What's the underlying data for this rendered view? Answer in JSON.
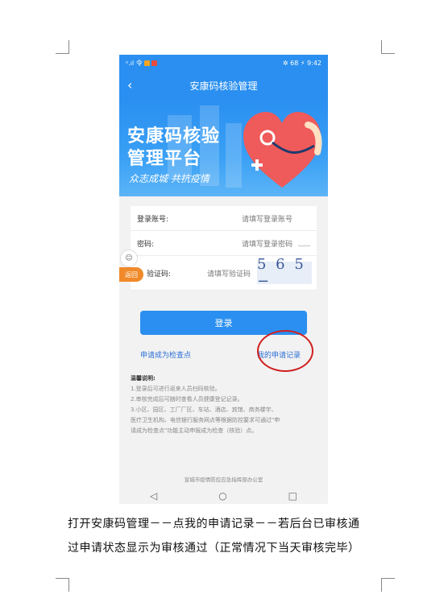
{
  "status_bar": {
    "left": "ᵘ.ıl 令",
    "right": "✲ 68 ⚡ 9:42"
  },
  "nav": {
    "back_icon": "‹",
    "title": "安康码核验管理"
  },
  "banner": {
    "line1": "安康码核验",
    "line2": "管理平台",
    "slogan": "众志成城 共抗疫情"
  },
  "form": {
    "account_label": "登录账号:",
    "account_placeholder": "请填写登录账号",
    "password_label": "密码:",
    "password_placeholder": "请填写登录密码",
    "eye_icon": "‿‿",
    "captcha_label": "验证码:",
    "captcha_placeholder": "请填写验证码",
    "captcha_text": "5 6 5 −"
  },
  "float": {
    "robot_icon": "☺",
    "return_label": "返回"
  },
  "login_button": "登录",
  "links": {
    "apply": "申请成为检查点",
    "records": "我的申请记录"
  },
  "tips": {
    "title": "温馨说明:",
    "items": [
      "1.登录后可进行返来人员扫码核验。",
      "2.审核完成后可随时查看人员健康登记记录。",
      "3.小区、园区、工厂厂区、车站、酒店、宾馆、商务楼宇、",
      "医疗卫生机构、电信银行服务网点等根据防控要求可通过\"申",
      "请成为检查点\"功能主动申报成为检查（核验）点。"
    ]
  },
  "footer": "宣城市疫情防控应急指挥部办公室",
  "system_nav": {
    "back": "◁",
    "home": "○",
    "recent": "□"
  },
  "caption": {
    "line1": "打开安康码管理－－点我的申请记录－－若后台已审核通",
    "line2": "过申请状态显示为审核通过（正常情况下当天审核完毕）"
  },
  "colors": {
    "primary": "#2a8ff0",
    "highlight_circle": "#d0201f",
    "return_badge": "#f08a2a"
  }
}
